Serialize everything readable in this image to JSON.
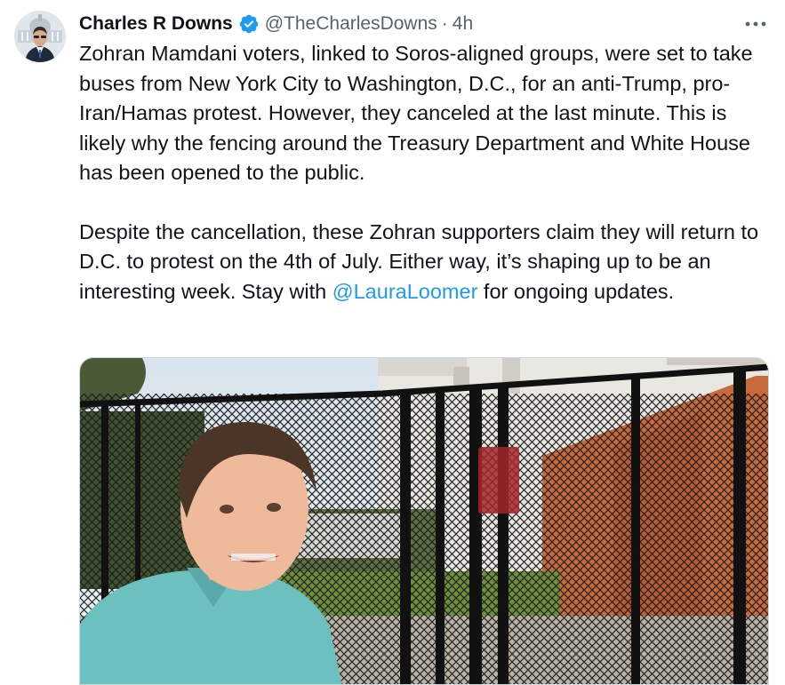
{
  "author": {
    "display_name": "Charles R Downs",
    "handle": "@TheCharlesDowns",
    "separator": "·",
    "time": "4h",
    "verified_icon": "verified-badge-icon",
    "avatar_icon": "profile-avatar"
  },
  "tweet": {
    "paragraph_1": "Zohran Mamdani voters, linked to Soros-aligned groups, were set to take buses from New York City to Washington, D.C., for an anti-Trump, pro-Iran/Hamas protest. However, they canceled at the last minute. This is likely why the fencing around the Treasury Department and White House has been opened to the public.",
    "paragraph_2_before": "Despite the cancellation, these Zohran supporters claim they will return to D.C. to protest on the 4th of July. Either way, it’s shaping up to be an interesting week. Stay with ",
    "mention": "@LauraLoomer",
    "paragraph_2_after": " for ongoing updates."
  },
  "media": {
    "type": "video-thumbnail",
    "icon": "video-media"
  },
  "colors": {
    "accent": "#1d9bf0",
    "text": "#0f1419",
    "secondary": "#536471"
  },
  "more_icon": "more-horizontal-icon"
}
